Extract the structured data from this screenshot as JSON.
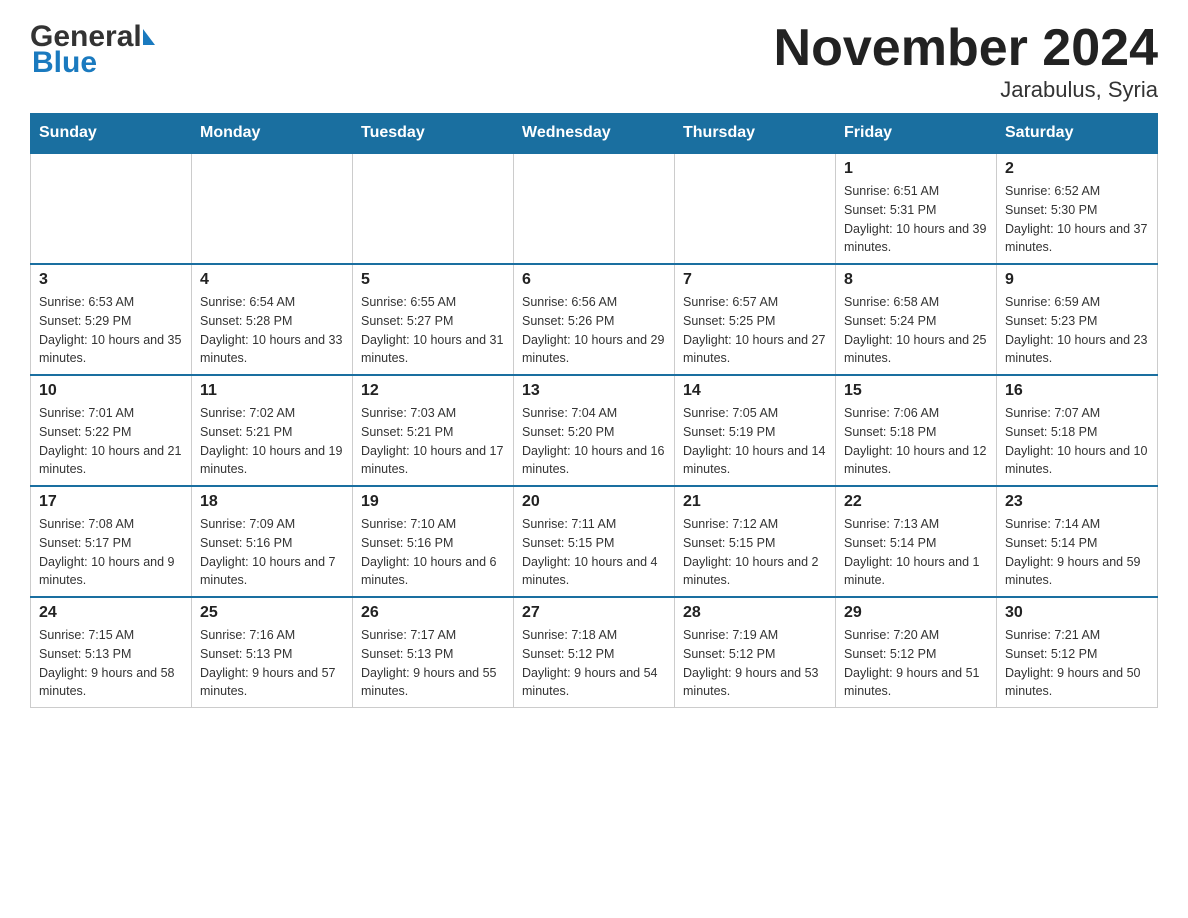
{
  "logo": {
    "part1": "General",
    "part2": "Blue"
  },
  "title": "November 2024",
  "subtitle": "Jarabulus, Syria",
  "weekdays": [
    "Sunday",
    "Monday",
    "Tuesday",
    "Wednesday",
    "Thursday",
    "Friday",
    "Saturday"
  ],
  "weeks": [
    [
      {
        "day": "",
        "sunrise": "",
        "sunset": "",
        "daylight": ""
      },
      {
        "day": "",
        "sunrise": "",
        "sunset": "",
        "daylight": ""
      },
      {
        "day": "",
        "sunrise": "",
        "sunset": "",
        "daylight": ""
      },
      {
        "day": "",
        "sunrise": "",
        "sunset": "",
        "daylight": ""
      },
      {
        "day": "",
        "sunrise": "",
        "sunset": "",
        "daylight": ""
      },
      {
        "day": "1",
        "sunrise": "Sunrise: 6:51 AM",
        "sunset": "Sunset: 5:31 PM",
        "daylight": "Daylight: 10 hours and 39 minutes."
      },
      {
        "day": "2",
        "sunrise": "Sunrise: 6:52 AM",
        "sunset": "Sunset: 5:30 PM",
        "daylight": "Daylight: 10 hours and 37 minutes."
      }
    ],
    [
      {
        "day": "3",
        "sunrise": "Sunrise: 6:53 AM",
        "sunset": "Sunset: 5:29 PM",
        "daylight": "Daylight: 10 hours and 35 minutes."
      },
      {
        "day": "4",
        "sunrise": "Sunrise: 6:54 AM",
        "sunset": "Sunset: 5:28 PM",
        "daylight": "Daylight: 10 hours and 33 minutes."
      },
      {
        "day": "5",
        "sunrise": "Sunrise: 6:55 AM",
        "sunset": "Sunset: 5:27 PM",
        "daylight": "Daylight: 10 hours and 31 minutes."
      },
      {
        "day": "6",
        "sunrise": "Sunrise: 6:56 AM",
        "sunset": "Sunset: 5:26 PM",
        "daylight": "Daylight: 10 hours and 29 minutes."
      },
      {
        "day": "7",
        "sunrise": "Sunrise: 6:57 AM",
        "sunset": "Sunset: 5:25 PM",
        "daylight": "Daylight: 10 hours and 27 minutes."
      },
      {
        "day": "8",
        "sunrise": "Sunrise: 6:58 AM",
        "sunset": "Sunset: 5:24 PM",
        "daylight": "Daylight: 10 hours and 25 minutes."
      },
      {
        "day": "9",
        "sunrise": "Sunrise: 6:59 AM",
        "sunset": "Sunset: 5:23 PM",
        "daylight": "Daylight: 10 hours and 23 minutes."
      }
    ],
    [
      {
        "day": "10",
        "sunrise": "Sunrise: 7:01 AM",
        "sunset": "Sunset: 5:22 PM",
        "daylight": "Daylight: 10 hours and 21 minutes."
      },
      {
        "day": "11",
        "sunrise": "Sunrise: 7:02 AM",
        "sunset": "Sunset: 5:21 PM",
        "daylight": "Daylight: 10 hours and 19 minutes."
      },
      {
        "day": "12",
        "sunrise": "Sunrise: 7:03 AM",
        "sunset": "Sunset: 5:21 PM",
        "daylight": "Daylight: 10 hours and 17 minutes."
      },
      {
        "day": "13",
        "sunrise": "Sunrise: 7:04 AM",
        "sunset": "Sunset: 5:20 PM",
        "daylight": "Daylight: 10 hours and 16 minutes."
      },
      {
        "day": "14",
        "sunrise": "Sunrise: 7:05 AM",
        "sunset": "Sunset: 5:19 PM",
        "daylight": "Daylight: 10 hours and 14 minutes."
      },
      {
        "day": "15",
        "sunrise": "Sunrise: 7:06 AM",
        "sunset": "Sunset: 5:18 PM",
        "daylight": "Daylight: 10 hours and 12 minutes."
      },
      {
        "day": "16",
        "sunrise": "Sunrise: 7:07 AM",
        "sunset": "Sunset: 5:18 PM",
        "daylight": "Daylight: 10 hours and 10 minutes."
      }
    ],
    [
      {
        "day": "17",
        "sunrise": "Sunrise: 7:08 AM",
        "sunset": "Sunset: 5:17 PM",
        "daylight": "Daylight: 10 hours and 9 minutes."
      },
      {
        "day": "18",
        "sunrise": "Sunrise: 7:09 AM",
        "sunset": "Sunset: 5:16 PM",
        "daylight": "Daylight: 10 hours and 7 minutes."
      },
      {
        "day": "19",
        "sunrise": "Sunrise: 7:10 AM",
        "sunset": "Sunset: 5:16 PM",
        "daylight": "Daylight: 10 hours and 6 minutes."
      },
      {
        "day": "20",
        "sunrise": "Sunrise: 7:11 AM",
        "sunset": "Sunset: 5:15 PM",
        "daylight": "Daylight: 10 hours and 4 minutes."
      },
      {
        "day": "21",
        "sunrise": "Sunrise: 7:12 AM",
        "sunset": "Sunset: 5:15 PM",
        "daylight": "Daylight: 10 hours and 2 minutes."
      },
      {
        "day": "22",
        "sunrise": "Sunrise: 7:13 AM",
        "sunset": "Sunset: 5:14 PM",
        "daylight": "Daylight: 10 hours and 1 minute."
      },
      {
        "day": "23",
        "sunrise": "Sunrise: 7:14 AM",
        "sunset": "Sunset: 5:14 PM",
        "daylight": "Daylight: 9 hours and 59 minutes."
      }
    ],
    [
      {
        "day": "24",
        "sunrise": "Sunrise: 7:15 AM",
        "sunset": "Sunset: 5:13 PM",
        "daylight": "Daylight: 9 hours and 58 minutes."
      },
      {
        "day": "25",
        "sunrise": "Sunrise: 7:16 AM",
        "sunset": "Sunset: 5:13 PM",
        "daylight": "Daylight: 9 hours and 57 minutes."
      },
      {
        "day": "26",
        "sunrise": "Sunrise: 7:17 AM",
        "sunset": "Sunset: 5:13 PM",
        "daylight": "Daylight: 9 hours and 55 minutes."
      },
      {
        "day": "27",
        "sunrise": "Sunrise: 7:18 AM",
        "sunset": "Sunset: 5:12 PM",
        "daylight": "Daylight: 9 hours and 54 minutes."
      },
      {
        "day": "28",
        "sunrise": "Sunrise: 7:19 AM",
        "sunset": "Sunset: 5:12 PM",
        "daylight": "Daylight: 9 hours and 53 minutes."
      },
      {
        "day": "29",
        "sunrise": "Sunrise: 7:20 AM",
        "sunset": "Sunset: 5:12 PM",
        "daylight": "Daylight: 9 hours and 51 minutes."
      },
      {
        "day": "30",
        "sunrise": "Sunrise: 7:21 AM",
        "sunset": "Sunset: 5:12 PM",
        "daylight": "Daylight: 9 hours and 50 minutes."
      }
    ]
  ]
}
